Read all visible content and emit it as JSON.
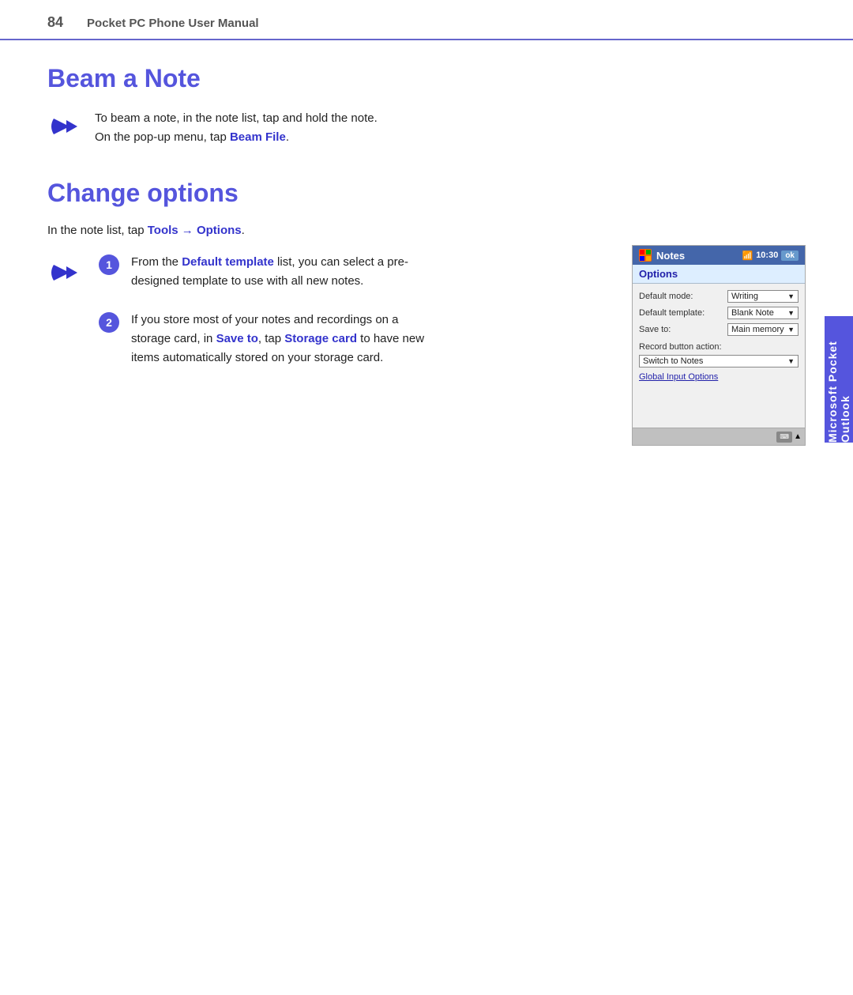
{
  "header": {
    "page_number": "84",
    "manual_title": "Pocket PC Phone User Manual"
  },
  "beam_section": {
    "heading": "Beam a Note",
    "body_text": "To beam a note, in the note list, tap and hold the note.",
    "body_text2": "On the pop-up menu, tap ",
    "beam_file_link": "Beam File",
    "period": "."
  },
  "change_options": {
    "heading": "Change options",
    "tools_line_prefix": "In the note list, tap ",
    "tools_link": "Tools → Options",
    "tools_period": ".",
    "step1": {
      "number": "1",
      "text_prefix": "From the ",
      "default_template_link": "Default template",
      "text_suffix": " list, you can select a pre-designed template to use with all new notes."
    },
    "step2": {
      "number": "2",
      "text_prefix": "If you store most of your notes and recordings on a storage card, in ",
      "save_to_link": "Save to",
      "text_middle": ", tap ",
      "storage_card_link": "Storage card",
      "text_suffix": " to have new items automatically stored on your storage card."
    }
  },
  "phone_screenshot": {
    "titlebar": {
      "app_name": "Notes",
      "signal_icon": "📶",
      "time": "10:30",
      "ok_label": "ok"
    },
    "options_bar": "Options",
    "default_mode_label": "Default mode:",
    "default_mode_value": "Writing",
    "default_template_label": "Default template:",
    "default_template_value": "Blank Note",
    "save_to_label": "Save to:",
    "save_to_value": "Main memory",
    "record_button_label": "Record button action:",
    "record_button_value": "Switch to Notes",
    "global_input_link": "Global Input Options"
  },
  "side_tab": {
    "line1": "Microsoft",
    "line2": "Pocket Outlook"
  }
}
